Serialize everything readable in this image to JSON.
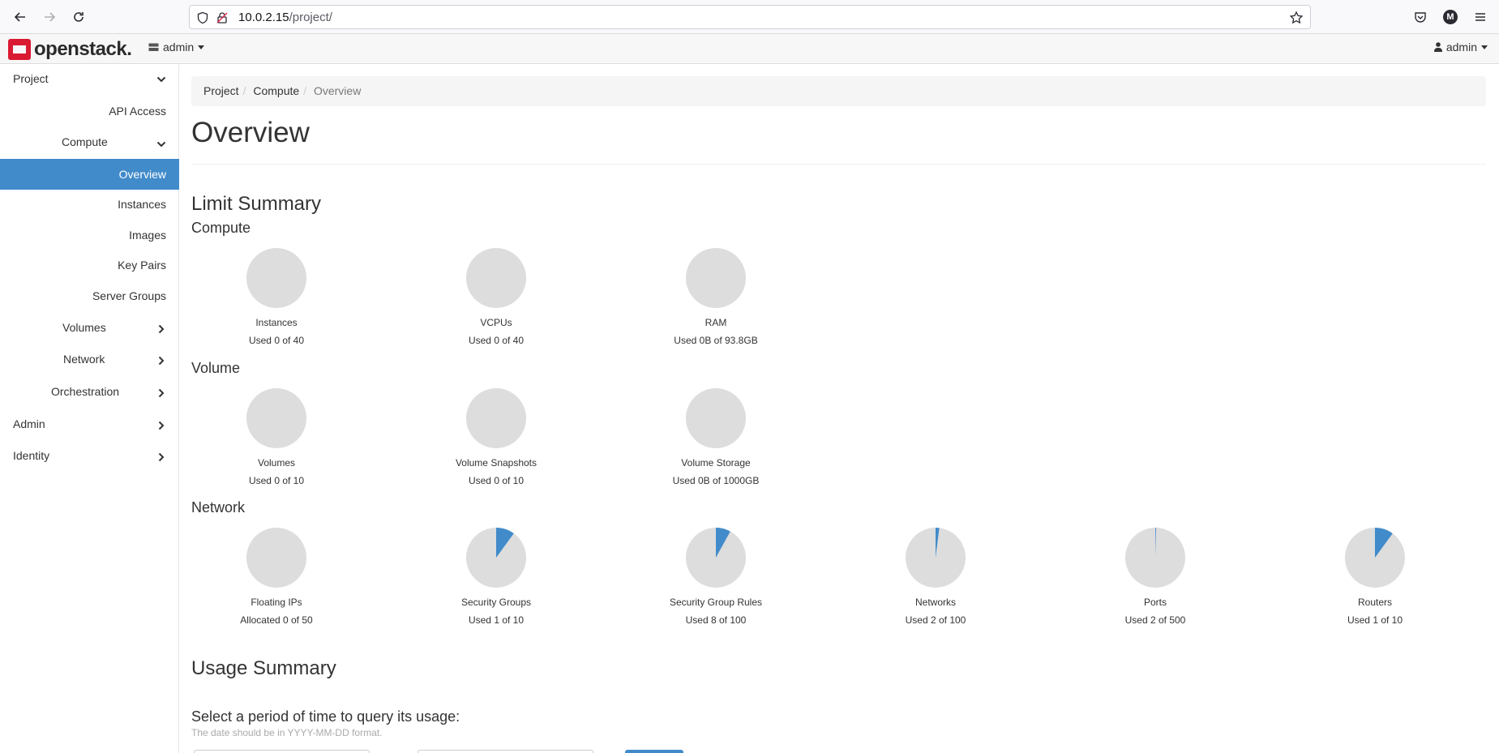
{
  "browser": {
    "url_host": "10.0.2.15",
    "url_path": "/project/",
    "profile_initial": "M"
  },
  "header": {
    "logo_text": "openstack.",
    "project": "admin",
    "user": "admin"
  },
  "sidebar": {
    "project": "Project",
    "api_access": "API Access",
    "compute": "Compute",
    "overview": "Overview",
    "instances": "Instances",
    "images": "Images",
    "key_pairs": "Key Pairs",
    "server_groups": "Server Groups",
    "volumes": "Volumes",
    "network": "Network",
    "orchestration": "Orchestration",
    "admin": "Admin",
    "identity": "Identity"
  },
  "breadcrumb": [
    "Project",
    "Compute",
    "Overview"
  ],
  "page_title": "Overview",
  "limit_summary": {
    "heading": "Limit Summary",
    "compute_heading": "Compute",
    "volume_heading": "Volume",
    "network_heading": "Network",
    "compute": [
      {
        "title": "Instances",
        "usage": "Used 0 of 40",
        "fraction": 0
      },
      {
        "title": "VCPUs",
        "usage": "Used 0 of 40",
        "fraction": 0
      },
      {
        "title": "RAM",
        "usage": "Used 0B of 93.8GB",
        "fraction": 0
      }
    ],
    "volume": [
      {
        "title": "Volumes",
        "usage": "Used 0 of 10",
        "fraction": 0
      },
      {
        "title": "Volume Snapshots",
        "usage": "Used 0 of 10",
        "fraction": 0
      },
      {
        "title": "Volume Storage",
        "usage": "Used 0B of 1000GB",
        "fraction": 0
      }
    ],
    "network": [
      {
        "title": "Floating IPs",
        "usage": "Allocated 0 of 50",
        "fraction": 0
      },
      {
        "title": "Security Groups",
        "usage": "Used 1 of 10",
        "fraction": 0.1
      },
      {
        "title": "Security Group Rules",
        "usage": "Used 8 of 100",
        "fraction": 0.08
      },
      {
        "title": "Networks",
        "usage": "Used 2 of 100",
        "fraction": 0.02
      },
      {
        "title": "Ports",
        "usage": "Used 2 of 500",
        "fraction": 0.004
      },
      {
        "title": "Routers",
        "usage": "Used 1 of 10",
        "fraction": 0.1
      }
    ]
  },
  "usage_summary": {
    "heading": "Usage Summary",
    "period_label": "Select a period of time to query its usage:",
    "help_text": "The date should be in YYYY-MM-DD format."
  },
  "colors": {
    "accent": "#428bca",
    "pie_bg": "#dddddd",
    "brand": "#da1a32"
  }
}
